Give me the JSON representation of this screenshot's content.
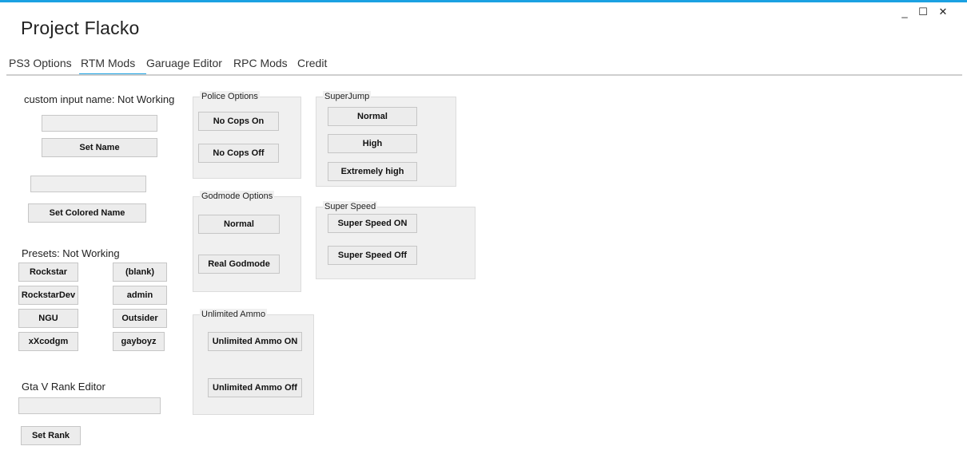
{
  "window": {
    "title": "Project Flacko",
    "minimize": "_",
    "maximize": "☐",
    "close": "✕"
  },
  "tabs": [
    {
      "label": "PS3 Options"
    },
    {
      "label": "RTM Mods",
      "active": true
    },
    {
      "label": "Garuage Editor"
    },
    {
      "label": "RPC Mods"
    },
    {
      "label": "Credit"
    }
  ],
  "left": {
    "custom_name_label": "custom input name: Not Working",
    "custom_name_value": "",
    "set_name": "Set Name",
    "colored_name_value": "",
    "set_colored_name": "Set Colored Name",
    "presets_label": "Presets: Not Working",
    "presets": [
      "Rockstar",
      "(blank)",
      "RockstarDev",
      "admin",
      "NGU",
      "Outsider",
      "xXcodgm",
      "gayboyz"
    ],
    "rank_label": "Gta V Rank Editor",
    "rank_value": "",
    "set_rank": "Set Rank"
  },
  "police": {
    "title": "Police Options",
    "on": "No Cops On",
    "off": "No Cops Off"
  },
  "godmode": {
    "title": "Godmode Options",
    "normal": "Normal",
    "real": "Real Godmode"
  },
  "ammo": {
    "title": "Unlimited Ammo",
    "on": "Unlimited Ammo ON",
    "off": "Unlimited Ammo Off"
  },
  "superjump": {
    "title": "SuperJump",
    "normal": "Normal",
    "high": "High",
    "extreme": "Extremely high"
  },
  "superspeed": {
    "title": "Super Speed",
    "on": "Super Speed ON",
    "off": "Super Speed Off"
  },
  "colors": {
    "accent": "#1ba1e2"
  }
}
